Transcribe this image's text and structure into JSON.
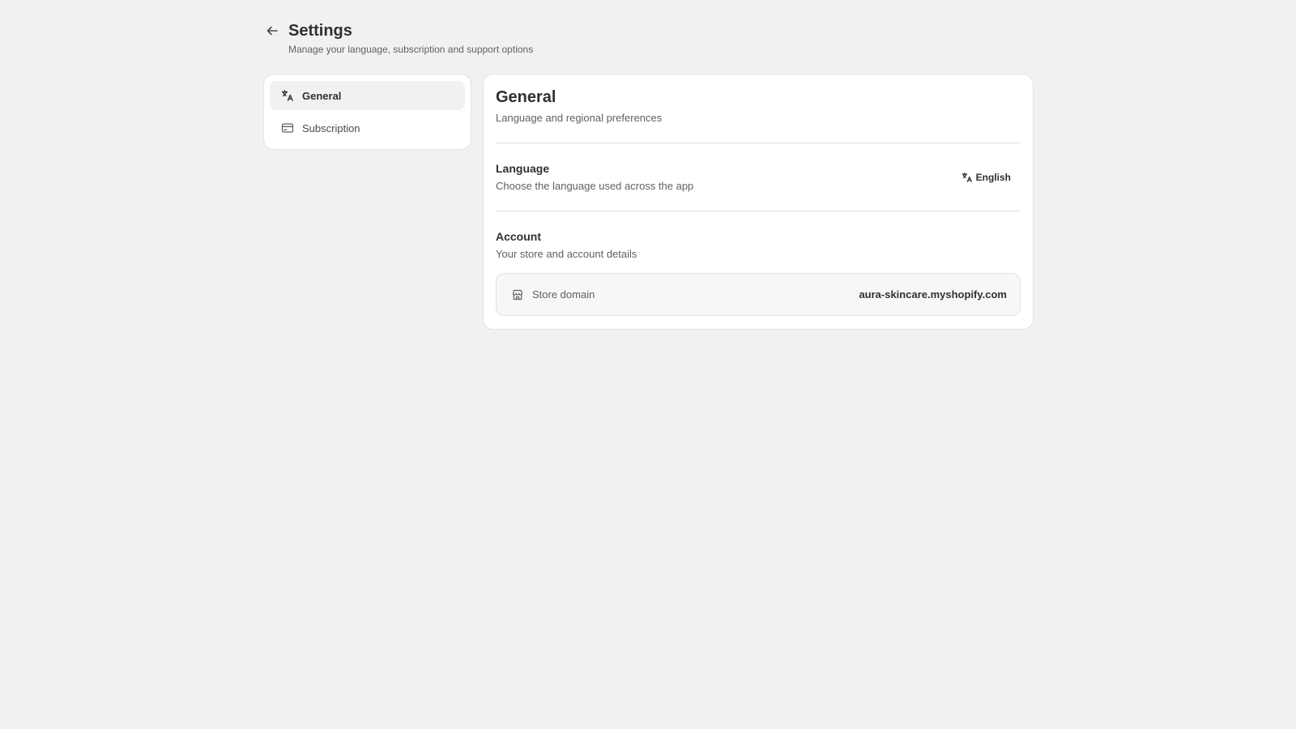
{
  "header": {
    "back_icon": "arrow-left-icon",
    "title": "Settings",
    "subtitle": "Manage your language, subscription and support options"
  },
  "nav": {
    "items": [
      {
        "label": "General",
        "icon": "language-icon",
        "active": true
      },
      {
        "label": "Subscription",
        "icon": "credit-card-icon",
        "active": false
      }
    ]
  },
  "general": {
    "title": "General",
    "subtitle": "Language and regional preferences",
    "language": {
      "title": "Language",
      "subtitle": "Choose the language used across the app",
      "button_label": "English",
      "button_icon": "language-icon"
    },
    "account": {
      "title": "Account",
      "subtitle": "Your store and account details",
      "domain_label": "Store domain",
      "domain_icon": "store-icon",
      "domain_value": "aura-skincare.myshopify.com"
    }
  },
  "colors": {
    "page_bg": "#f1f1f1",
    "card_bg": "#ffffff",
    "text_primary": "#303030",
    "text_secondary": "#616161",
    "active_nav_bg": "#f1f1f1"
  }
}
